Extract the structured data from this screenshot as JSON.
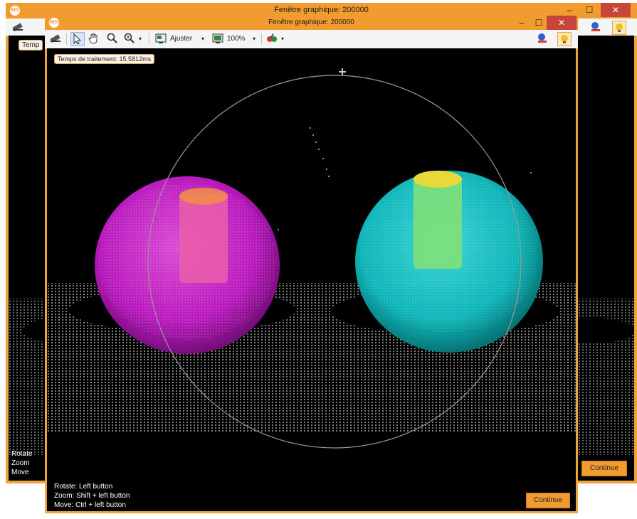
{
  "back_window": {
    "title": "Fenêtre graphique: 200000",
    "timing_label": "Temp",
    "help": [
      "Rotate",
      "Zoom",
      "Move"
    ],
    "continue_label": "Continue",
    "minimize": "–",
    "maximize": "☐",
    "close": "✕"
  },
  "front_window": {
    "title": "Fenêtre graphique: 200000",
    "minimize": "–",
    "maximize": "☐",
    "close": "✕",
    "toolbar": {
      "fit_label": "Ajuster",
      "zoom_label": "100%"
    },
    "timing_label": "Temps de traitement: 15.5812ms",
    "help": {
      "rotate": "Rotate: Left button",
      "zoom": "Zoom:  Shift + left button",
      "move": "Move:  Ctrl  + left button"
    },
    "continue_label": "Continue"
  },
  "colors": {
    "accent": "#f29b2f",
    "close": "#c8453a",
    "magenta_sphere": "#d21fd6",
    "cyan_sphere": "#12c5c8",
    "cylinder_orange": "#f07a3a",
    "cylinder_yellow": "#e8d83a"
  }
}
